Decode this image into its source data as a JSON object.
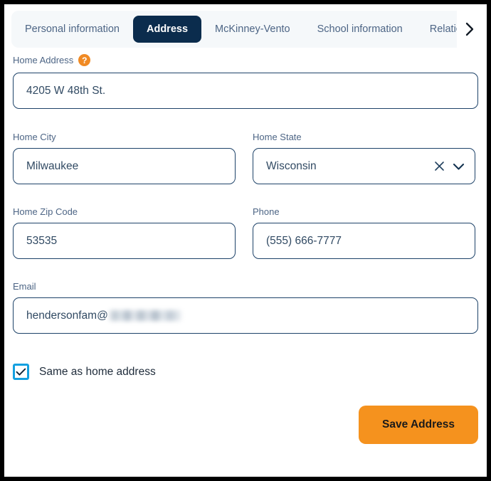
{
  "tabs": {
    "items": [
      {
        "label": "Personal information",
        "active": false
      },
      {
        "label": "Address",
        "active": true
      },
      {
        "label": "McKinney-Vento",
        "active": false
      },
      {
        "label": "School information",
        "active": false
      },
      {
        "label": "Relationsh",
        "active": false
      }
    ],
    "scroll_next_icon": "chevron-right-icon"
  },
  "form": {
    "home_address": {
      "label": "Home Address",
      "help_icon": "question-mark-icon",
      "help_glyph": "?",
      "value": "4205 W 48th St."
    },
    "home_city": {
      "label": "Home City",
      "value": "Milwaukee"
    },
    "home_state": {
      "label": "Home State",
      "value": "Wisconsin",
      "clear_icon": "close-x-icon",
      "dropdown_icon": "chevron-down-icon"
    },
    "home_zip_code": {
      "label": "Home Zip Code",
      "value": "53535"
    },
    "phone": {
      "label": "Phone",
      "value": "(555) 666-7777"
    },
    "email": {
      "label": "Email",
      "value": "hendersonfam@",
      "redacted_domain": true
    },
    "same_as_home_address": {
      "label": "Same as home address",
      "checked": true,
      "check_icon": "checkmark-icon"
    },
    "save_button": {
      "label": "Save Address"
    }
  },
  "colors": {
    "active_tab_bg": "#0b2c4d",
    "tab_strip_bg": "#f5f8fa",
    "input_border": "#1d4268",
    "label_text": "#4d6585",
    "accent_orange": "#f5921e",
    "help_orange": "#f08a24",
    "checkbox_blue": "#13a0e0",
    "frame": "#000000"
  }
}
